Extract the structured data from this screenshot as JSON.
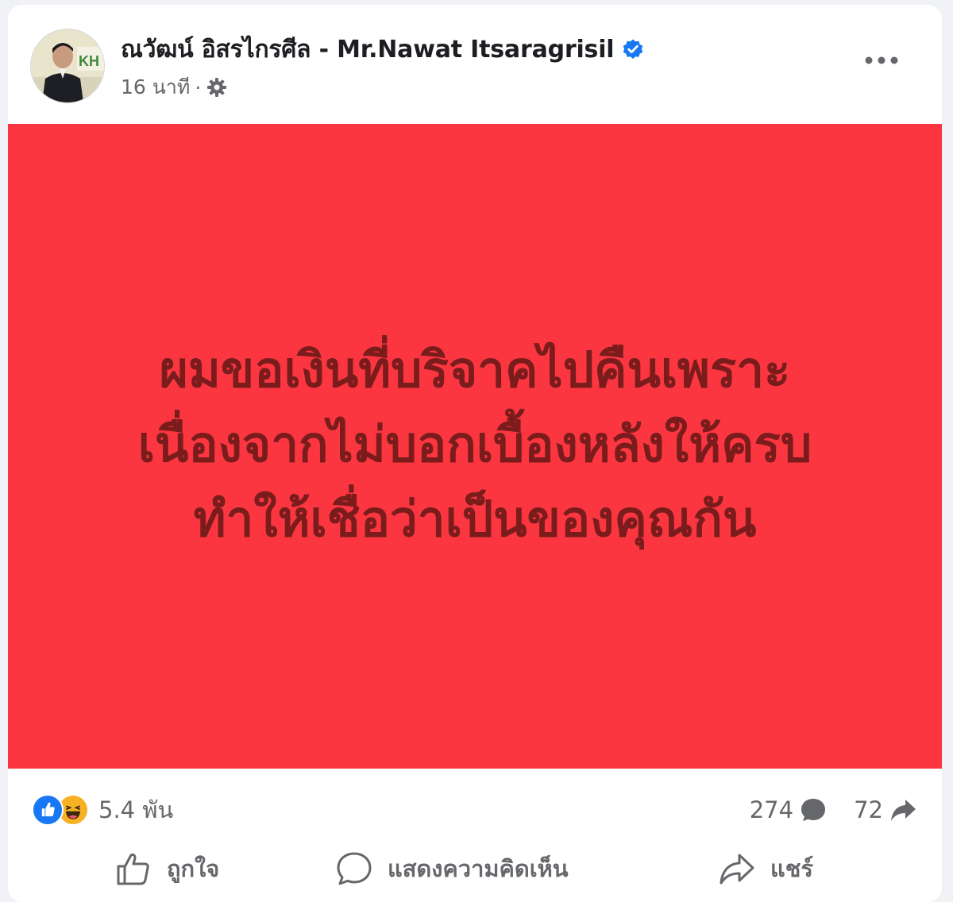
{
  "post": {
    "author": {
      "name": "ณวัฒน์ อิสรไกรศีล - Mr.Nawat Itsaragrisil",
      "verified": true
    },
    "timestamp": "16 นาที",
    "separator": "·",
    "privacy_icon": "settings-icon",
    "more_icon": "more-options-icon",
    "image": {
      "background_color": "#fb3640",
      "text_color": "#7a1c1c",
      "lines": [
        "ผมขอเงินที่บริจาคไปคืนเพราะ",
        "เนื่องจากไม่บอกเบื้องหลังให้ครบ",
        "ทำให้เชื่อว่าเป็นของคุณกัน"
      ]
    },
    "reactions": {
      "icons": [
        "like-reaction-icon",
        "haha-reaction-icon"
      ],
      "count": "5.4 พัน"
    },
    "comments_count": "274",
    "shares_count": "72",
    "actions": {
      "like_label": "ถูกใจ",
      "comment_label": "แสดงความคิดเห็น",
      "share_label": "แชร์"
    },
    "colors": {
      "accent_blue": "#1877f2",
      "secondary_text": "#65676b",
      "primary_text": "#1c1e21"
    }
  }
}
